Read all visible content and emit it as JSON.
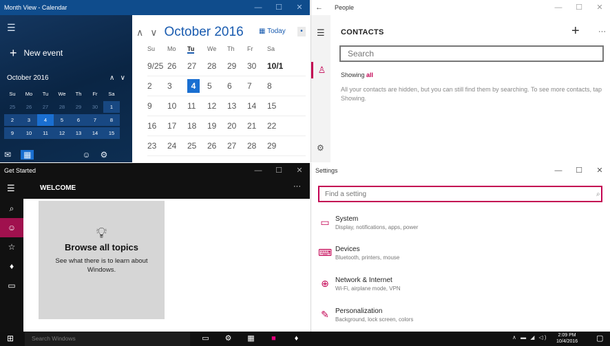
{
  "calendar": {
    "window_title": "Month View - Calendar",
    "caption": {
      "min": "—",
      "max": "☐",
      "close": "✕"
    },
    "hamburger_icon": "☰",
    "new_event_label": "New event",
    "mini_month": "October 2016",
    "mini_nav": {
      "up": "∧",
      "down": "∨"
    },
    "mini_days": [
      "Su",
      "Mo",
      "Tu",
      "We",
      "Th",
      "Fr",
      "Sa"
    ],
    "mini_weeks": [
      [
        "25",
        "26",
        "27",
        "28",
        "29",
        "30",
        "1"
      ],
      [
        "2",
        "3",
        "4",
        "5",
        "6",
        "7",
        "8"
      ],
      [
        "9",
        "10",
        "11",
        "12",
        "13",
        "14",
        "15"
      ]
    ],
    "month_title": "October 2016",
    "nav_up": "∧",
    "nav_down": "∨",
    "today_label": "Today",
    "more": "•",
    "weekdays": [
      "Su",
      "Mo",
      "Tu",
      "We",
      "Th",
      "Fr",
      "Sa"
    ],
    "weeks": [
      [
        "9/25",
        "26",
        "27",
        "28",
        "29",
        "30",
        "10/1"
      ],
      [
        "2",
        "3",
        "4",
        "5",
        "6",
        "7",
        "8"
      ],
      [
        "9",
        "10",
        "11",
        "12",
        "13",
        "14",
        "15"
      ],
      [
        "16",
        "17",
        "18",
        "19",
        "20",
        "21",
        "22"
      ],
      [
        "23",
        "24",
        "25",
        "26",
        "27",
        "28",
        "29"
      ]
    ]
  },
  "people": {
    "window_title": "People",
    "back": "←",
    "caption": {
      "min": "—",
      "max": "☐",
      "close": "✕"
    },
    "hamburger_icon": "☰",
    "title": "CONTACTS",
    "add": "+",
    "more": "···",
    "search_placeholder": "Search",
    "showing_label": "Showing",
    "showing_value": "all",
    "note": "All your contacts are hidden, but you can still find them by searching. To see more contacts, tap Showing."
  },
  "get_started": {
    "window_title": "Get Started",
    "caption": {
      "min": "—",
      "max": "☐",
      "close": "✕"
    },
    "section_title": "WELCOME",
    "more": "···",
    "tile_title": "Browse all topics",
    "tile_desc": "See what there is to learn about Windows."
  },
  "settings": {
    "window_title": "Settings",
    "caption": {
      "min": "—",
      "max": "☐",
      "close": "✕"
    },
    "search_placeholder": "Find a setting",
    "items": [
      {
        "name": "System",
        "desc": "Display, notifications, apps, power"
      },
      {
        "name": "Devices",
        "desc": "Bluetooth, printers, mouse"
      },
      {
        "name": "Network & Internet",
        "desc": "Wi-Fi, airplane mode, VPN"
      },
      {
        "name": "Personalization",
        "desc": "Background, lock screen, colors"
      }
    ]
  },
  "taskbar": {
    "search_placeholder": "Search Windows",
    "time": "2:09 PM",
    "date": "10/4/2016"
  },
  "colors": {
    "accent_blue": "#1a6fd1",
    "calendar_titlebar": "#0f4c8c",
    "accent_pink": "#c30052"
  }
}
